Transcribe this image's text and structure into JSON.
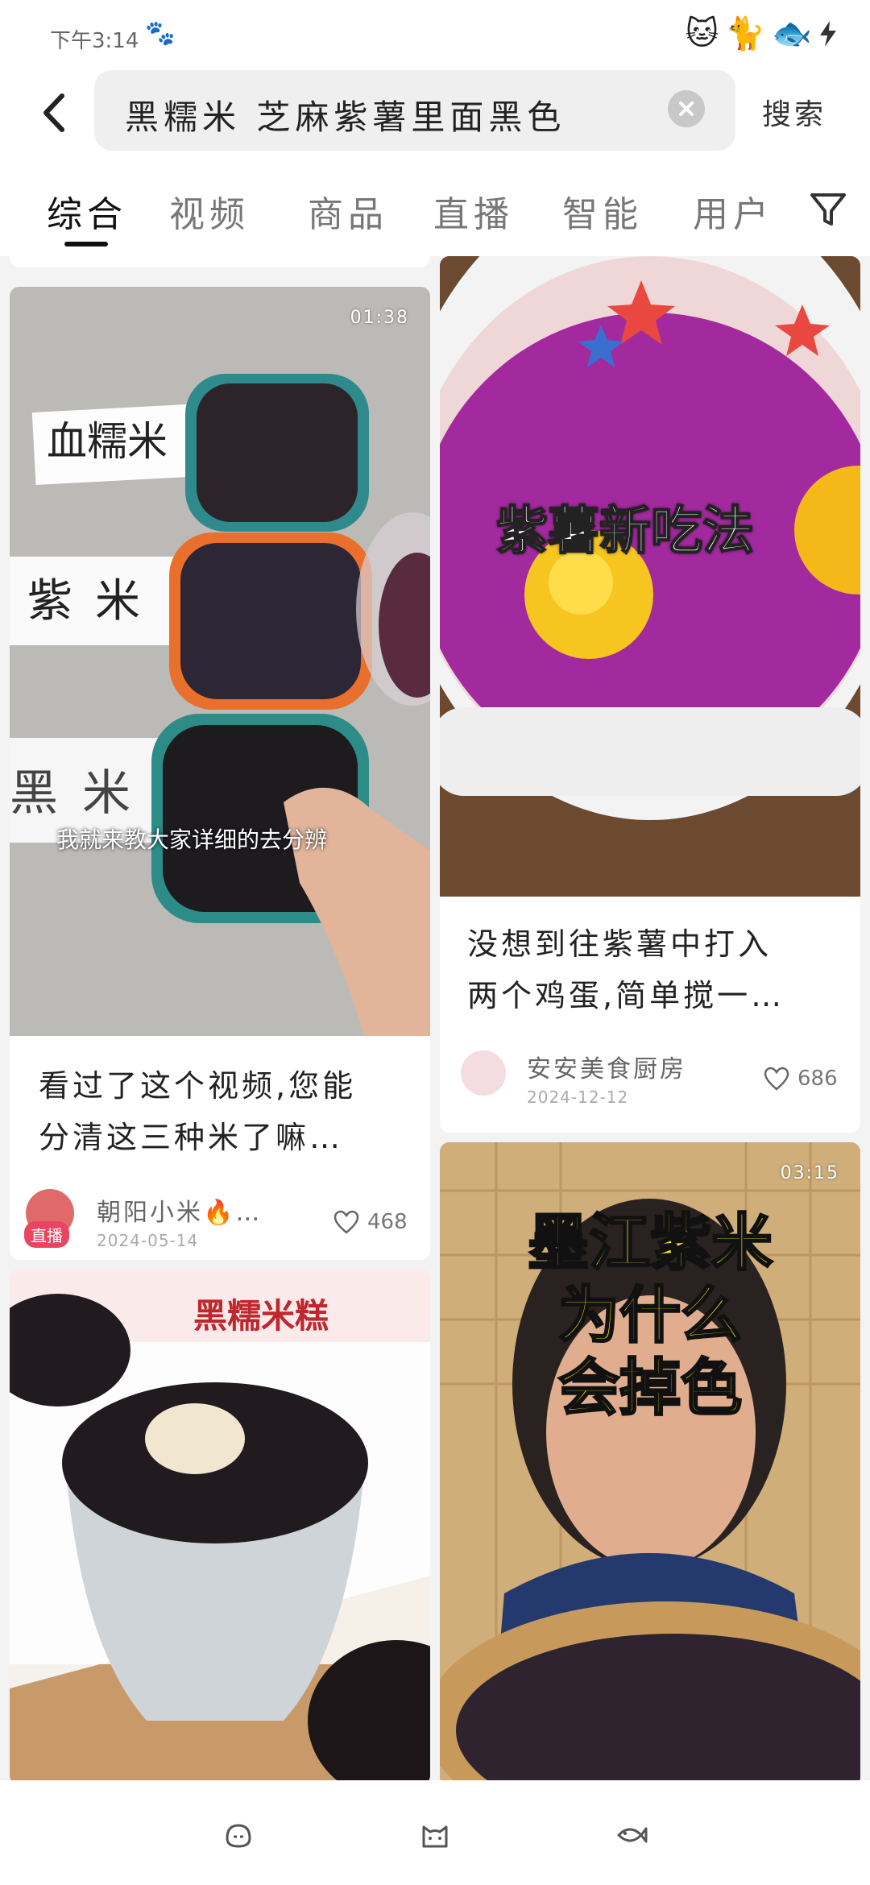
{
  "status": {
    "time": "下午3:14",
    "left_icon": "cat-face",
    "right_icons": [
      "cat-sticker",
      "cat-sticker",
      "fish-sticker",
      "charging-bolt"
    ]
  },
  "search": {
    "query": "黑糯米 芝麻紫薯里面黑色",
    "submit_label": "搜索"
  },
  "tabs": [
    {
      "label": "综合"
    },
    {
      "label": "视频"
    },
    {
      "label": "商品"
    },
    {
      "label": "直播"
    },
    {
      "label": "智能"
    },
    {
      "label": "用户"
    }
  ],
  "cards": {
    "rice": {
      "duration": "01:38",
      "labels": [
        "血糯米",
        "紫米",
        "黑米"
      ],
      "subtitle": "我就来教大家详细的去分辨",
      "title": [
        "看过了这个视频,您能",
        "分清这三种米了嘛…"
      ],
      "author": "朝阳小米🔥…",
      "badge": "直播",
      "date": "2024-05-14",
      "likes": "468"
    },
    "sweetpotato": {
      "overlay": "紫薯新吃法",
      "title": [
        "没想到往紫薯中打入",
        "两个鸡蛋,简单搅一…"
      ],
      "author": "安安美食厨房",
      "date": "2024-12-12",
      "likes": "686"
    },
    "cake": {
      "overlay": "黑糯米糕"
    },
    "mojiang": {
      "duration": "03:15",
      "overlay": [
        "墨江紫米",
        "为什么",
        "会掉色"
      ]
    }
  },
  "bottom_nav": [
    "home-icon",
    "cat-icon",
    "fish-icon"
  ]
}
